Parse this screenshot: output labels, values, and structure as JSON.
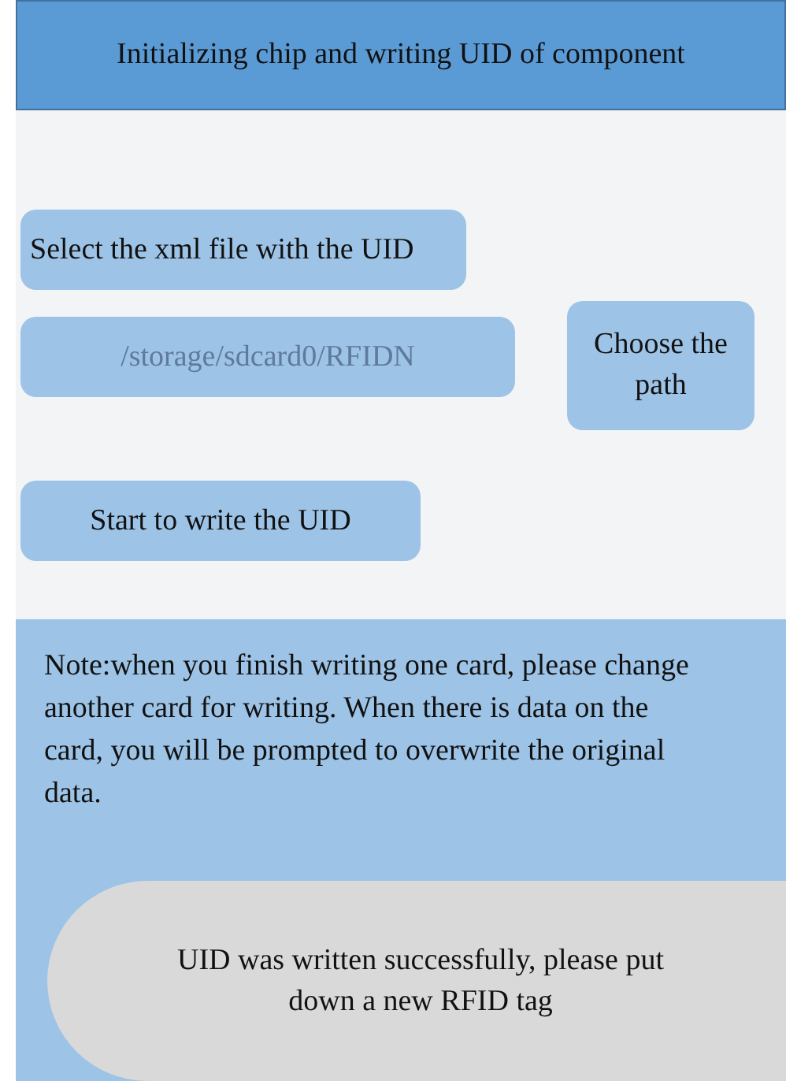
{
  "header": {
    "title": "Initializing chip and writing UID of component"
  },
  "select_button": {
    "label": "Select the xml file with the UID"
  },
  "path_field": {
    "value": "/storage/sdcard0/RFIDN"
  },
  "choose_button": {
    "label": "Choose the path"
  },
  "start_button": {
    "label": "Start to write the UID"
  },
  "note": {
    "text": "Note:when you finish writing one card, please change another card for writing. When there is data on the card, you will be prompted to overwrite the original data."
  },
  "toast": {
    "text": "UID was written successfully, please put down a new RFID tag"
  }
}
